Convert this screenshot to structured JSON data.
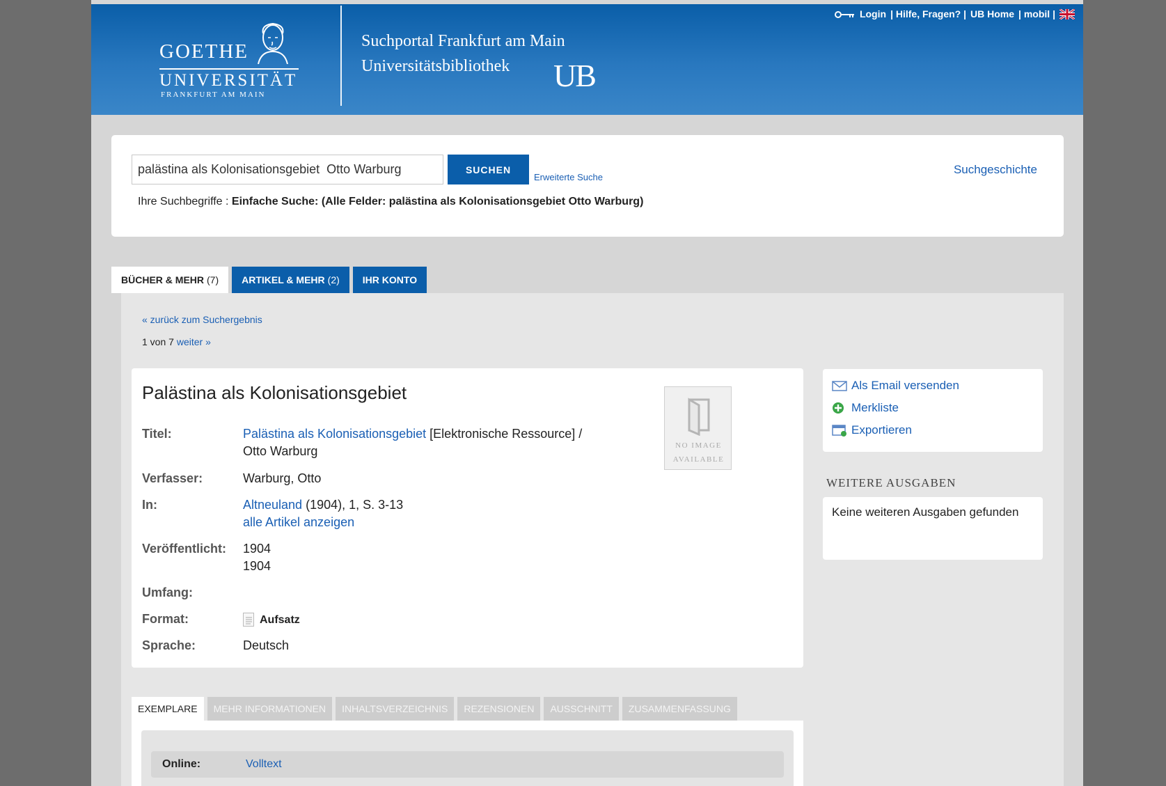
{
  "header": {
    "logo_line1": "GOETHE",
    "logo_line2": "UNIVERSITÄT",
    "logo_line3": "FRANKFURT AM MAIN",
    "portal_title": "Suchportal Frankfurt am Main",
    "portal_subtitle": "Universitätsbibliothek",
    "ub_mark": "UB",
    "links": {
      "login": "Login",
      "sep1": "| Hilfe, Fragen? |",
      "ub_home": "UB Home",
      "sep2": "| mobil |"
    }
  },
  "search": {
    "query": "palästina als Kolonisationsgebiet  Otto Warburg",
    "button_label": "SUCHEN",
    "advanced_label": "Erweiterte Suche",
    "history_label": "Suchgeschichte",
    "terms_prefix": "Ihre Suchbegriffe : ",
    "terms_value": "Einfache Suche: (Alle Felder: palästina als Kolonisationsgebiet Otto Warburg)"
  },
  "tabs": [
    {
      "label": "BÜCHER & MEHR",
      "count": "(7)",
      "active": true
    },
    {
      "label": "ARTIKEL & MEHR",
      "count": "(2)",
      "active": false
    },
    {
      "label": "IHR KONTO",
      "count": "",
      "active": false
    }
  ],
  "navigation": {
    "back": "« zurück zum Suchergebnis",
    "position": "1 von 7",
    "next": "weiter »"
  },
  "record": {
    "title": "Palästina als Kolonisationsgebiet",
    "no_image_1": "NO IMAGE",
    "no_image_2": "AVAILABLE",
    "fields": {
      "titel_label": "Titel:",
      "titel_link": "Palästina als Kolonisationsgebiet",
      "titel_rest": " [Elektronische Ressource] /",
      "titel_line2": "Otto Warburg",
      "verfasser_label": "Verfasser:",
      "verfasser_value": "Warburg, Otto",
      "in_label": "In:",
      "in_link": "Altneuland",
      "in_rest": " (1904), 1, S. 3-13",
      "in_line2": "alle Artikel anzeigen",
      "veroeff_label": "Veröffentlicht:",
      "veroeff_line1": "1904",
      "veroeff_line2": "1904",
      "umfang_label": "Umfang:",
      "format_label": "Format:",
      "format_value": "Aufsatz",
      "sprache_label": "Sprache:",
      "sprache_value": "Deutsch"
    }
  },
  "actions": {
    "email": "Als Email versenden",
    "merkliste": "Merkliste",
    "export": "Exportieren"
  },
  "editions": {
    "heading": "WEITERE AUSGABEN",
    "text": "Keine weiteren Ausgaben gefunden"
  },
  "detail_tabs": [
    {
      "label": "EXEMPLARE",
      "active": true
    },
    {
      "label": "MEHR INFORMATIONEN",
      "active": false
    },
    {
      "label": "INHALTSVERZEICHNIS",
      "active": false
    },
    {
      "label": "REZENSIONEN",
      "active": false
    },
    {
      "label": "AUSSCHNITT",
      "active": false
    },
    {
      "label": "ZUSAMMENFASSUNG",
      "active": false
    }
  ],
  "holdings": {
    "online_label": "Online:",
    "online_link": "Volltext"
  },
  "colors": {
    "brand_blue": "#0b5eaa",
    "link": "#1a5fb4"
  }
}
